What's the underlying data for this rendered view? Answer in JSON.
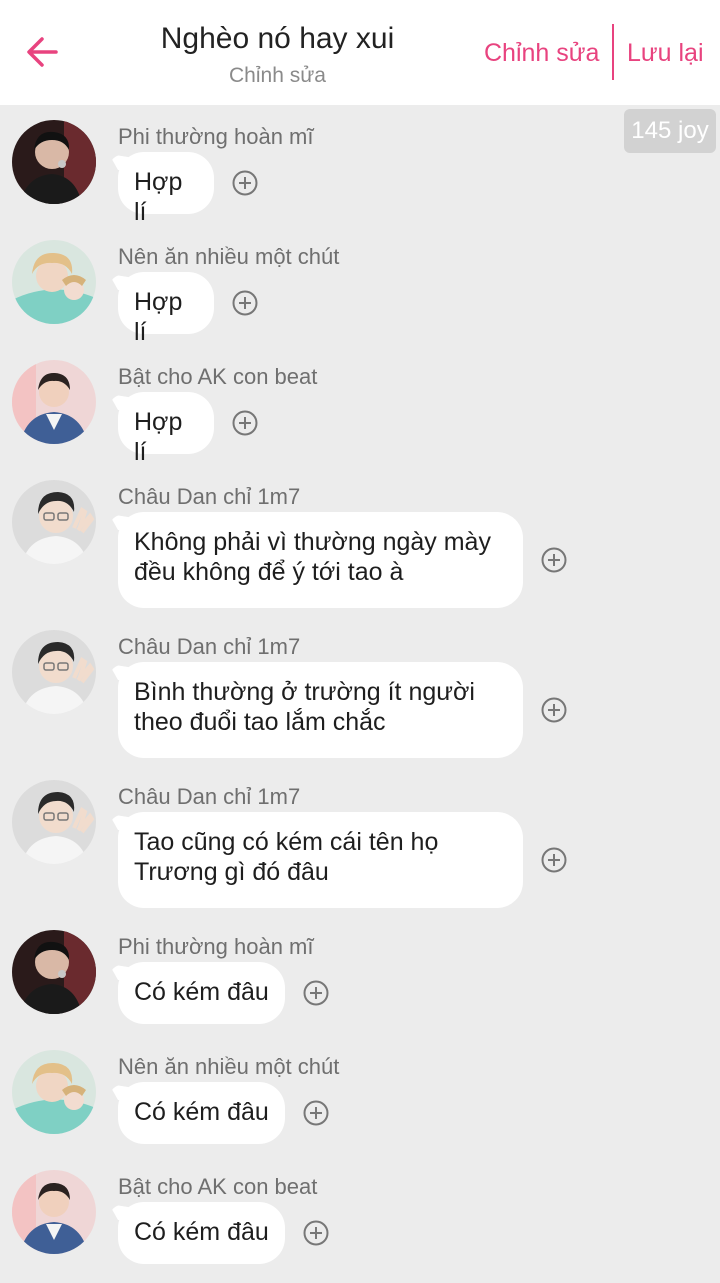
{
  "header": {
    "title": "Nghèo nó hay xui",
    "subtitle": "Chỉnh sửa",
    "edit_label": "Chỉnh sửa",
    "save_label": "Lưu lại",
    "back_icon": "arrow-left-icon",
    "accent_color": "#e8437f"
  },
  "joy_badge": "145 joy",
  "messages": [
    {
      "sender": "Phi thường hoàn mĩ",
      "text": "Hợp lí",
      "avatar": "avatar-dark-mic"
    },
    {
      "sender": "Nên ăn nhiều một chút",
      "text": "Hợp lí",
      "avatar": "avatar-blond-teal"
    },
    {
      "sender": "Bật cho AK con beat",
      "text": "Hợp lí",
      "avatar": "avatar-blue-jacket"
    },
    {
      "sender": "Châu Dan chỉ 1m7",
      "text": "Không phải vì thường ngày mày\nđều không để ý tới tao à",
      "avatar": "avatar-peace-sign"
    },
    {
      "sender": "Châu Dan chỉ 1m7",
      "text": "Bình thường ở trường ít người\ntheo đuổi tao lắm chắc",
      "avatar": "avatar-peace-sign"
    },
    {
      "sender": "Châu Dan chỉ 1m7",
      "text": "Tao cũng có kém cái tên họ\nTrương gì đó đâu",
      "avatar": "avatar-peace-sign"
    },
    {
      "sender": "Phi thường hoàn mĩ",
      "text": "Có kém đâu",
      "avatar": "avatar-dark-mic"
    },
    {
      "sender": "Nên ăn nhiều một chút",
      "text": "Có kém đâu",
      "avatar": "avatar-blond-teal"
    },
    {
      "sender": "Bật cho AK con beat",
      "text": "Có kém đâu",
      "avatar": "avatar-blue-jacket"
    }
  ]
}
